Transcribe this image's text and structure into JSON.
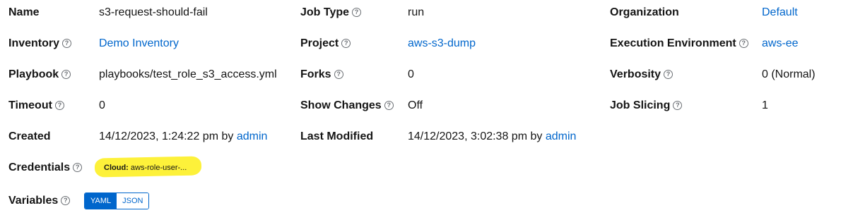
{
  "details": {
    "name": {
      "label": "Name",
      "value": "s3-request-should-fail"
    },
    "job_type": {
      "label": "Job Type",
      "value": "run"
    },
    "organization": {
      "label": "Organization",
      "value": "Default"
    },
    "inventory": {
      "label": "Inventory",
      "value": "Demo Inventory"
    },
    "project": {
      "label": "Project",
      "value": "aws-s3-dump"
    },
    "execution_environment": {
      "label": "Execution Environment",
      "value": "aws-ee"
    },
    "playbook": {
      "label": "Playbook",
      "value": "playbooks/test_role_s3_access.yml"
    },
    "forks": {
      "label": "Forks",
      "value": "0"
    },
    "verbosity": {
      "label": "Verbosity",
      "value": "0 (Normal)"
    },
    "timeout": {
      "label": "Timeout",
      "value": "0"
    },
    "show_changes": {
      "label": "Show Changes",
      "value": "Off"
    },
    "job_slicing": {
      "label": "Job Slicing",
      "value": "1"
    },
    "created": {
      "label": "Created",
      "value": "14/12/2023, 1:24:22 pm by",
      "user": "admin"
    },
    "last_modified": {
      "label": "Last Modified",
      "value": "14/12/2023, 3:02:38 pm by",
      "user": "admin"
    },
    "credentials": {
      "label": "Credentials",
      "chip_kind": "Cloud:",
      "chip_name": "aws-role-user-..."
    },
    "variables": {
      "label": "Variables",
      "modes": [
        "YAML",
        "JSON"
      ],
      "active_mode": "YAML"
    }
  },
  "help_icon": "question-circle-icon",
  "colors": {
    "link": "#0066cc",
    "highlight": "#fdf13a",
    "text": "#151515",
    "toggle_active": "#0066cc"
  }
}
